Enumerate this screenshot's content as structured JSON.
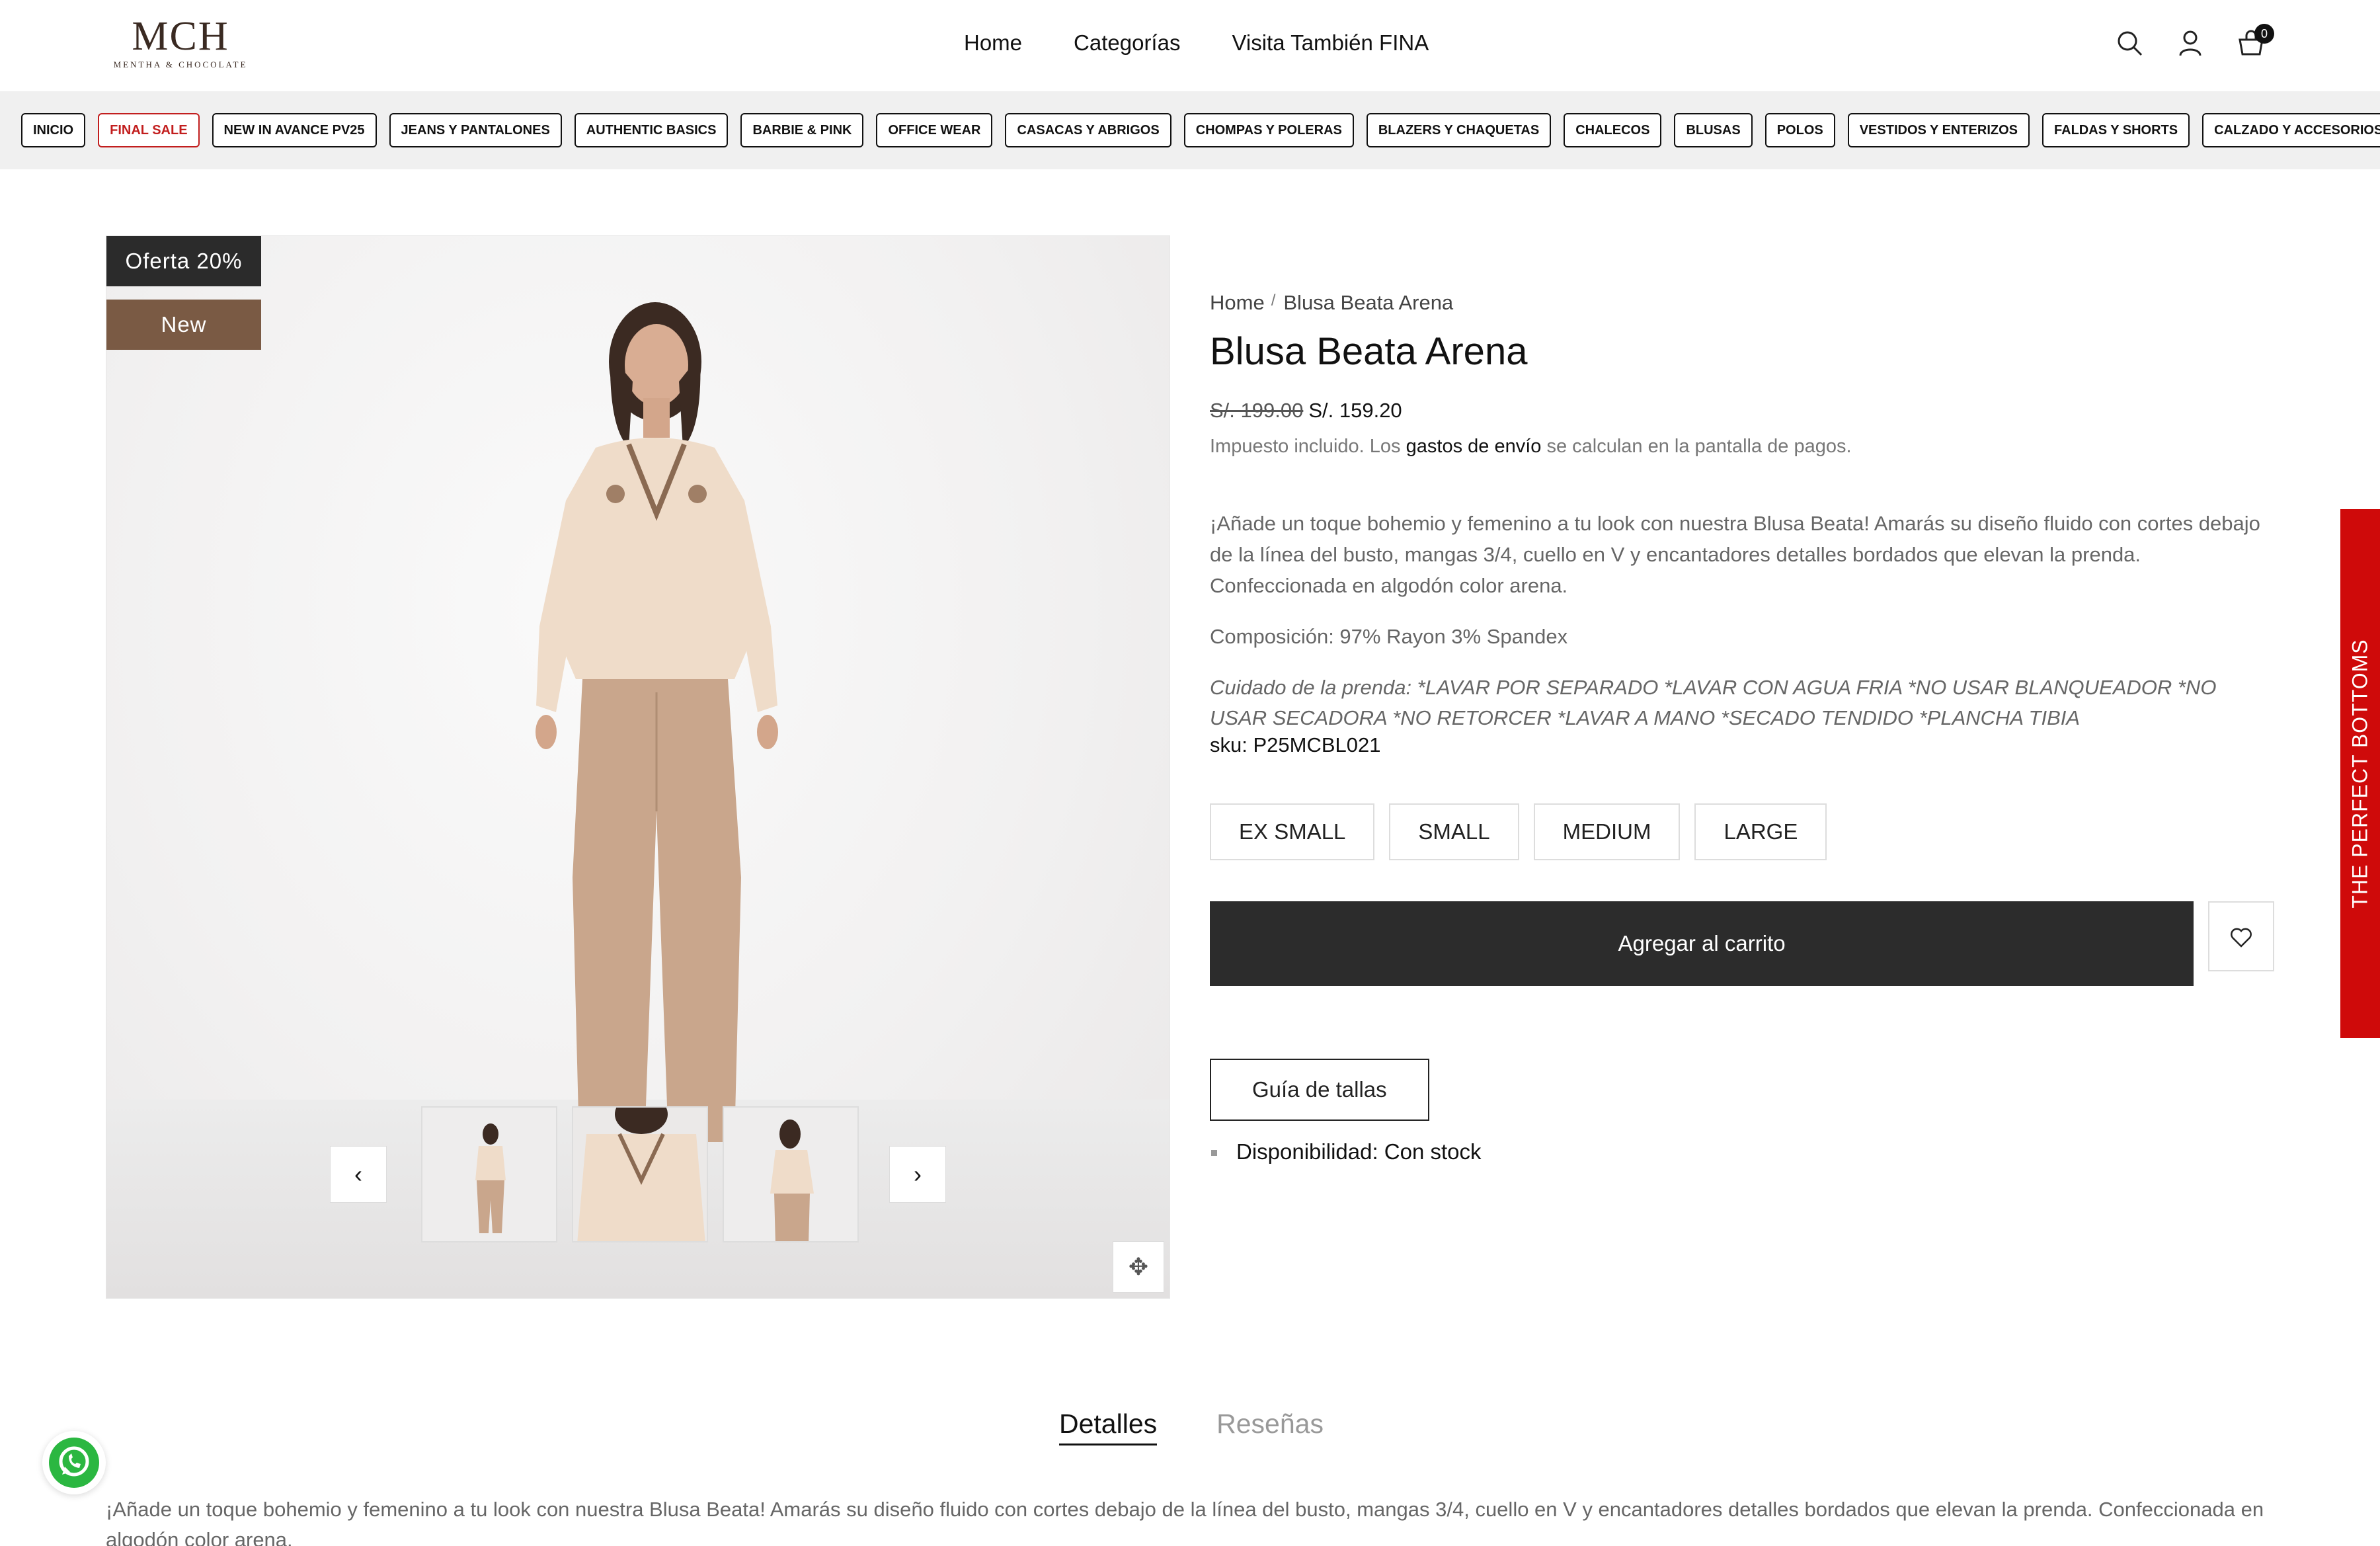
{
  "header": {
    "logo_mark": "MCH",
    "logo_sub": "MENTHA & CHOCOLATE",
    "nav": [
      "Home",
      "Categorías",
      "Visita También FINA"
    ],
    "cart_count": "0"
  },
  "categories": [
    "INICIO",
    "FINAL SALE",
    "NEW IN AVANCE PV25",
    "JEANS Y PANTALONES",
    "AUTHENTIC BASICS",
    "BARBIE & PINK",
    "OFFICE WEAR",
    "CASACAS Y ABRIGOS",
    "CHOMPAS Y POLERAS",
    "BLAZERS Y CHAQUETAS",
    "CHALECOS",
    "BLUSAS",
    "POLOS",
    "VESTIDOS Y ENTERIZOS",
    "FALDAS Y SHORTS",
    "CALZADO Y ACCESORIOS"
  ],
  "gallery": {
    "badge_sale": "Oferta 20%",
    "badge_new": "New",
    "prev": "‹",
    "next": "›"
  },
  "product": {
    "breadcrumb_home": "Home",
    "breadcrumb_sep": "/",
    "breadcrumb_current": "Blusa Beata Arena",
    "title": "Blusa Beata Arena",
    "price_old": "S/. 199.00",
    "price_new": "S/. 159.20",
    "tax_pre": "Impuesto incluido. Los ",
    "tax_link": "gastos de envío",
    "tax_post": " se calculan en la pantalla de pagos.",
    "description": "¡Añade un toque bohemio y femenino a tu look con nuestra Blusa Beata! Amarás su diseño fluido con cortes debajo de la línea del busto, mangas 3/4, cuello en V y encantadores detalles bordados que elevan la prenda. Confeccionada en algodón color arena.",
    "composition": "Composición: 97% Rayon 3% Spandex",
    "care": "Cuidado de la prenda: *LAVAR POR SEPARADO *LAVAR CON AGUA FRIA *NO USAR BLANQUEADOR *NO USAR SECADORA *NO RETORCER *LAVAR A MANO *SECADO TENDIDO *PLANCHA TIBIA",
    "sku": "sku: P25MCBL021",
    "sizes": [
      "EX SMALL",
      "SMALL",
      "MEDIUM",
      "LARGE"
    ],
    "add_to_cart": "Agregar al carrito",
    "size_guide": "Guía de tallas",
    "availability": "Disponibilidad: Con stock"
  },
  "side_tab": "THE PERFECT BOTTOMS",
  "tabs": {
    "details": "Detalles",
    "reviews": "Reseñas"
  },
  "bottom_description": "¡Añade un toque bohemio y femenino a tu look con nuestra Blusa Beata! Amarás su diseño fluido con cortes debajo de la línea del busto, mangas 3/4, cuello en V y encantadores detalles bordados que elevan la prenda. Confeccionada en algodón color arena.",
  "colors": {
    "sale_red": "#c21e1e",
    "new_brown": "#7a5a44",
    "button_dark": "#2c2c2c",
    "side_tab_red": "#cf0a0a",
    "whatsapp_green": "#2bb741"
  }
}
